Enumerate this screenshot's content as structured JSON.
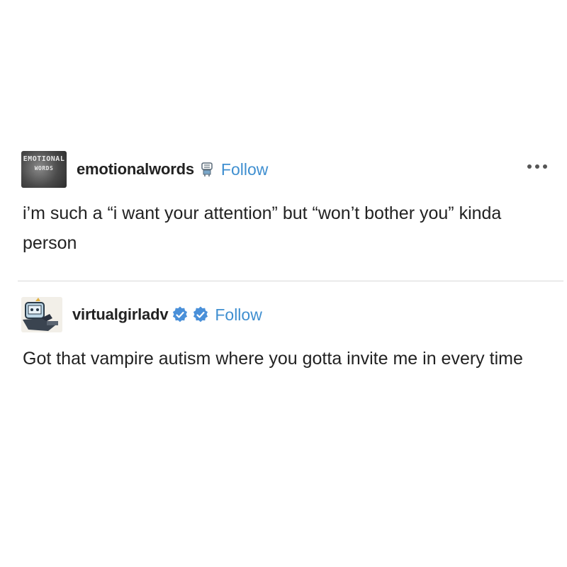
{
  "posts": [
    {
      "username": "emotionalwords",
      "avatar_text": [
        "EMOTIONAL",
        "WORDS"
      ],
      "follow_label": "Follow",
      "text": "i’m such a “i want your attention” but “won’t bother you” kinda person",
      "icons": [
        "robot-icon",
        "more-options-icon"
      ]
    },
    {
      "username": "virtualgirladv",
      "follow_label": "Follow",
      "text": "Got that vampire autism where you gotta invite me in every time",
      "icons": [
        "verified-badge-icon",
        "verified-badge-icon"
      ]
    }
  ],
  "colors": {
    "follow": "#3f8fd0",
    "verified": "#4a90d9",
    "text": "#222222",
    "divider": "#d8d8d8"
  }
}
